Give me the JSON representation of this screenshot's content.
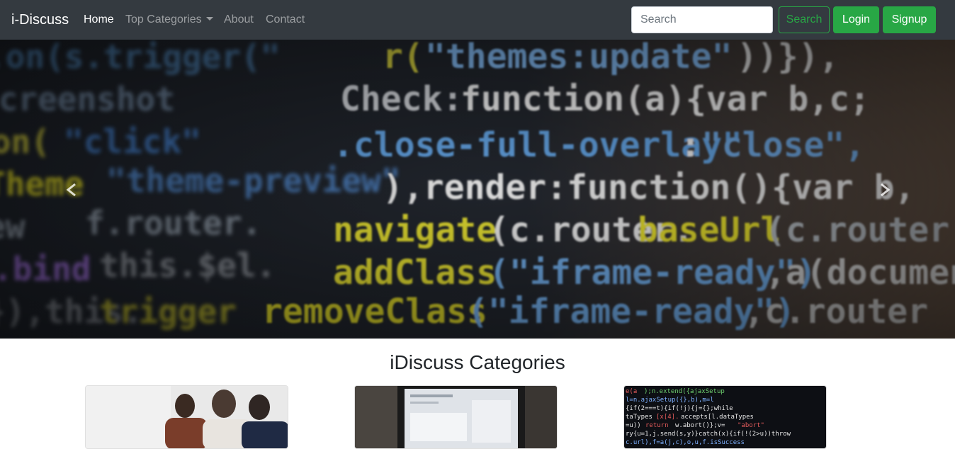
{
  "navbar": {
    "brand": "i-Discuss",
    "links": [
      {
        "label": "Home",
        "active": true
      },
      {
        "label": "Top Categories",
        "dropdown": true
      },
      {
        "label": "About"
      },
      {
        "label": "Contact"
      }
    ],
    "search_placeholder": "Search",
    "search_button": "Search",
    "login_button": "Login",
    "signup_button": "Signup"
  },
  "carousel": {
    "image": "code-on-screen",
    "prev_icon": "chevron-left-icon",
    "next_icon": "chevron-right-icon"
  },
  "categories_section": {
    "title": "iDiscuss Categories",
    "cards": [
      {
        "image": "people-discussing-photo"
      },
      {
        "image": "laptop-dashboard-photo"
      },
      {
        "image": "code-screen-photo"
      }
    ]
  },
  "colors": {
    "navbar_bg": "#343a40",
    "accent_green": "#28a745"
  }
}
